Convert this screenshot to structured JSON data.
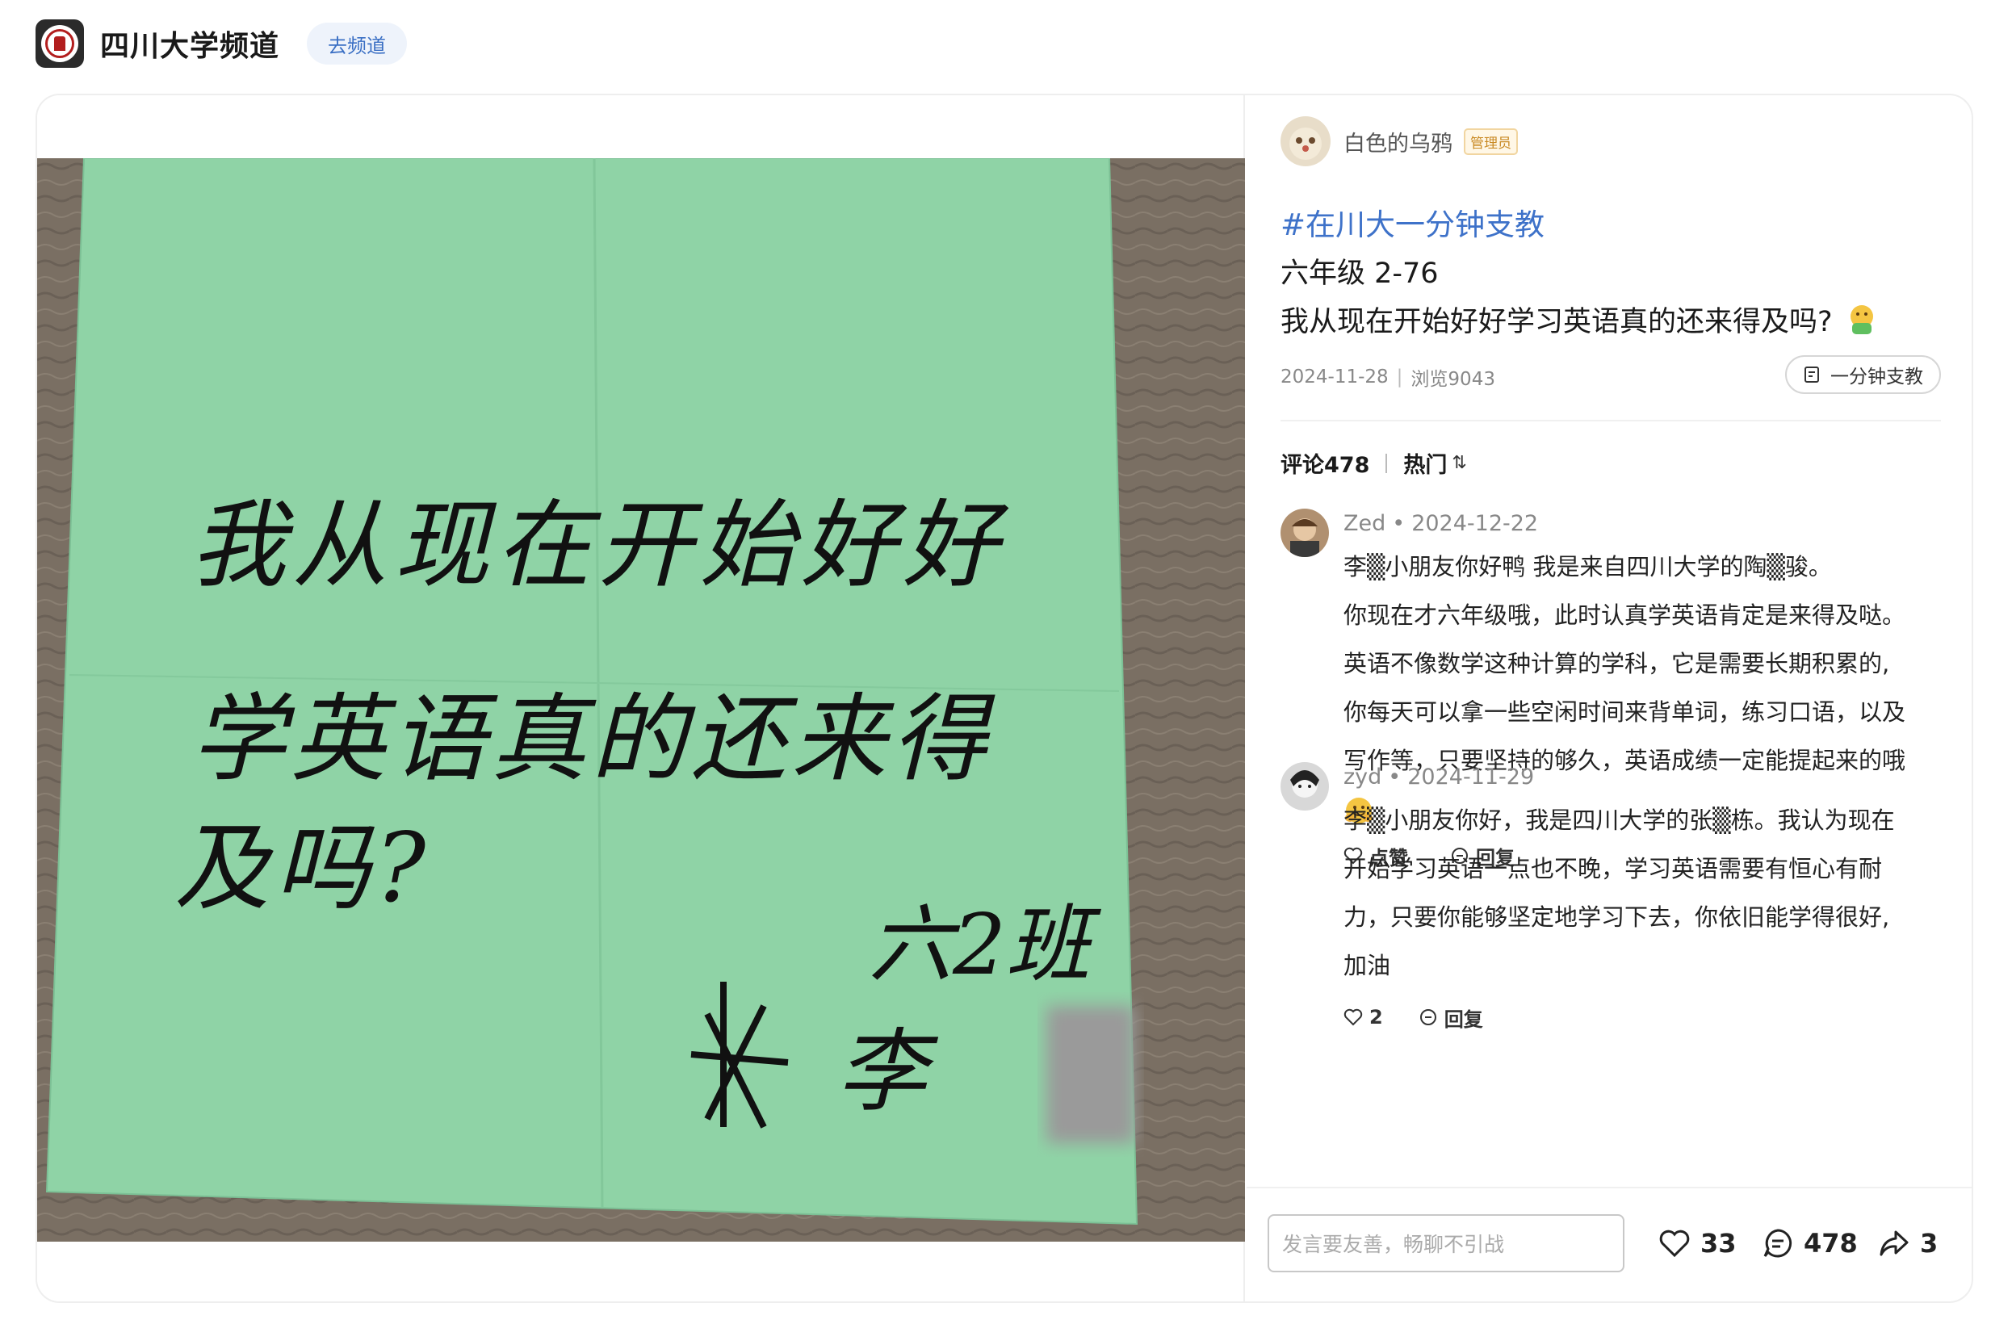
{
  "header": {
    "channel_name": "四川大学频道",
    "go_channel_label": "去频道"
  },
  "post": {
    "author": "白色的乌鸦",
    "author_badge": "管理员",
    "hashtag": "#在川大一分钟支教",
    "line1": "六年级 2-76",
    "line2": "我从现在开始好好学习英语真的还来得及吗?",
    "date": "2024-11-28",
    "views": "浏览9043",
    "tag_button": "一分钟支教",
    "note_lines": [
      "我从现在开始好好",
      "学英语真的还来得",
      "及吗?"
    ],
    "note_signature": [
      "六2班",
      "李"
    ]
  },
  "comments_bar": {
    "count_label": "评论478",
    "sort_label": "热门",
    "sort_icon": "⇅"
  },
  "comments": [
    {
      "user": "Zed",
      "date": "2024-12-22",
      "lines": [
        "李▒小朋友你好鸭 我是来自四川大学的陶▒骏。",
        "你现在才六年级哦，此时认真学英语肯定是来得及哒。",
        "英语不像数学这种计算的学科，它是需要长期积累的,",
        "你每天可以拿一些空闲时间来背单词，练习口语，以及",
        "写作等，只要坚持的够久，英语成绩一定能提起来的哦"
      ],
      "like_label": "点赞",
      "reply_label": "回复"
    },
    {
      "user": "zyd",
      "date": "2024-11-29",
      "lines": [
        "李▒小朋友你好，我是四川大学的张▒栋。我认为现在",
        "开始学习英语一点也不晚，学习英语需要有恒心有耐",
        "力，只要你能够坚定地学习下去，你依旧能学得很好,",
        "加油"
      ],
      "like_label": "2",
      "reply_label": "回复"
    }
  ],
  "bottom": {
    "input_placeholder": "发言要友善，畅聊不引战",
    "likes": "33",
    "comments": "478",
    "shares": "3"
  },
  "colors": {
    "link_blue": "#3e72c9",
    "note_green": "#8fd3a6",
    "admin_orange": "#c98a25"
  },
  "icons": [
    "heart-icon",
    "comment-icon",
    "share-icon",
    "edit-icon",
    "sort-icon"
  ]
}
